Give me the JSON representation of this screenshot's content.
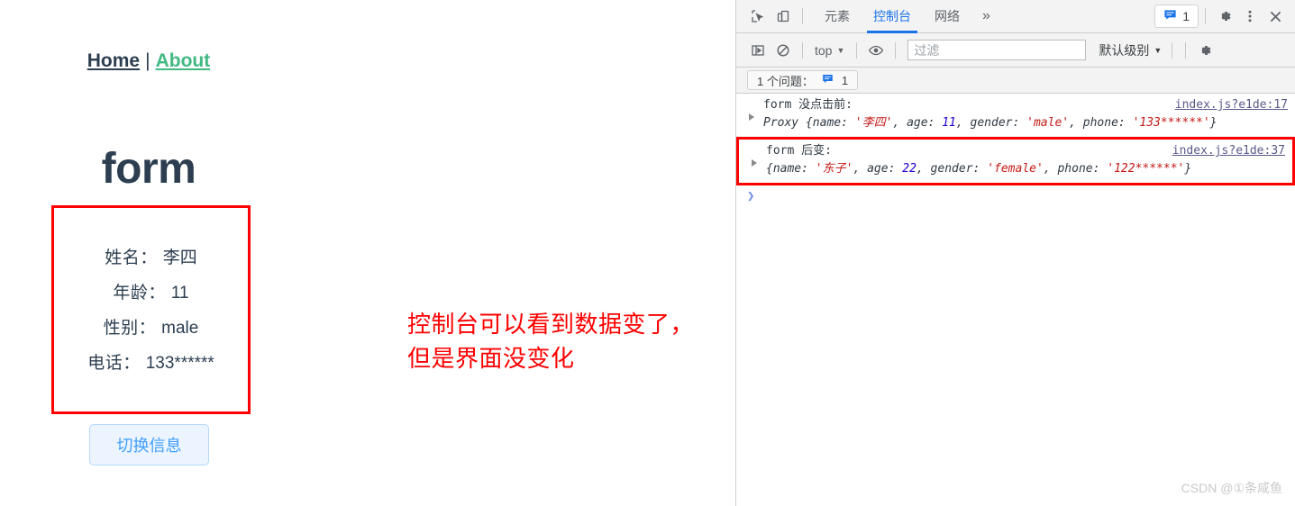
{
  "page": {
    "nav": {
      "home_label": "Home",
      "separator": "|",
      "about_label": "About"
    },
    "title": "form",
    "form_rows": [
      {
        "label": "姓名：",
        "value": "李四"
      },
      {
        "label": "年龄：",
        "value": "11"
      },
      {
        "label": "性别：",
        "value": "male"
      },
      {
        "label": "电话：",
        "value": "133******"
      }
    ],
    "toggle_button_label": "切换信息",
    "annotation_line1": "控制台可以看到数据变了，",
    "annotation_line2": "但是界面没变化",
    "colors": {
      "home_link": "#2c3e50",
      "about_link": "#42b983",
      "annotation_red": "#fe0000",
      "button_text": "#409eff",
      "button_bg": "#ecf5ff"
    }
  },
  "devtools": {
    "toolbar": {
      "inspect_icon": "inspect-element-icon",
      "device_icon": "device-toolbar-icon",
      "tabs": [
        {
          "label": "元素",
          "active": false
        },
        {
          "label": "控制台",
          "active": true
        },
        {
          "label": "网络",
          "active": false
        }
      ],
      "more_tabs_label": "»",
      "message_count": "1",
      "settings_icon": "gear-icon",
      "kebab_icon": "more-options-icon",
      "close_icon": "close-icon"
    },
    "console_toolbar": {
      "sidebar_toggle_icon": "console-sidebar-icon",
      "clear_icon": "clear-console-icon",
      "context_label": "top",
      "eye_icon": "live-expression-icon",
      "filter_placeholder": "过滤",
      "filter_value": "",
      "level_label": "默认级别",
      "settings_icon": "console-settings-icon"
    },
    "issues_bar": {
      "text": "1 个问题：",
      "count": "1"
    },
    "logs": [
      {
        "label_mono": "form",
        "label_cjk": " 没点击前:",
        "source": "index.js?e1de:17",
        "class_name": "Proxy ",
        "object_parts": [
          {
            "t": "key",
            "v": "{name: "
          },
          {
            "t": "str",
            "v": "'李四'"
          },
          {
            "t": "key",
            "v": ", age: "
          },
          {
            "t": "num",
            "v": "11"
          },
          {
            "t": "key",
            "v": ", gender: "
          },
          {
            "t": "str",
            "v": "'male'"
          },
          {
            "t": "key",
            "v": ", phone: "
          },
          {
            "t": "str",
            "v": "'133******'"
          },
          {
            "t": "key",
            "v": "}"
          }
        ],
        "boxed": false
      },
      {
        "label_mono": "form",
        "label_cjk": " 后变:",
        "source": "index.js?e1de:37",
        "class_name": "",
        "object_parts": [
          {
            "t": "key",
            "v": "{name: "
          },
          {
            "t": "str",
            "v": "'东子'"
          },
          {
            "t": "key",
            "v": ", age: "
          },
          {
            "t": "num",
            "v": "22"
          },
          {
            "t": "key",
            "v": ", gender: "
          },
          {
            "t": "str",
            "v": "'female'"
          },
          {
            "t": "key",
            "v": ", phone: "
          },
          {
            "t": "str",
            "v": "'122******'"
          },
          {
            "t": "key",
            "v": "}"
          }
        ],
        "boxed": true
      }
    ],
    "prompt_symbol": "❯"
  },
  "watermark": "CSDN @①条咸鱼"
}
